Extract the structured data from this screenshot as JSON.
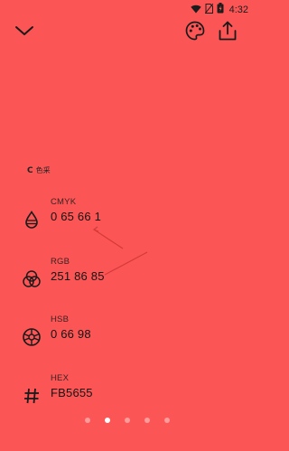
{
  "app": {
    "background": "#FB5655"
  },
  "statusbar": {
    "time": "4:32"
  },
  "topbar": {
    "collapse_icon": "chevron-down-icon",
    "palette_icon": "palette-icon",
    "share_icon": "share-icon"
  },
  "brand": {
    "logo_text": "C",
    "name": "色采"
  },
  "color_rows": [
    {
      "label": "CMYK",
      "value": "0 65 66 1",
      "icon": "drop-icon"
    },
    {
      "label": "RGB",
      "value": "251 86 85",
      "icon": "rgb-circles-icon"
    },
    {
      "label": "HSB",
      "value": "0 66 98",
      "icon": "color-wheel-icon"
    },
    {
      "label": "HEX",
      "value": "FB5655",
      "icon": "hash-icon"
    }
  ],
  "pager": {
    "count": 5,
    "active_index": 1
  },
  "annotation_color": "#d83a3a"
}
